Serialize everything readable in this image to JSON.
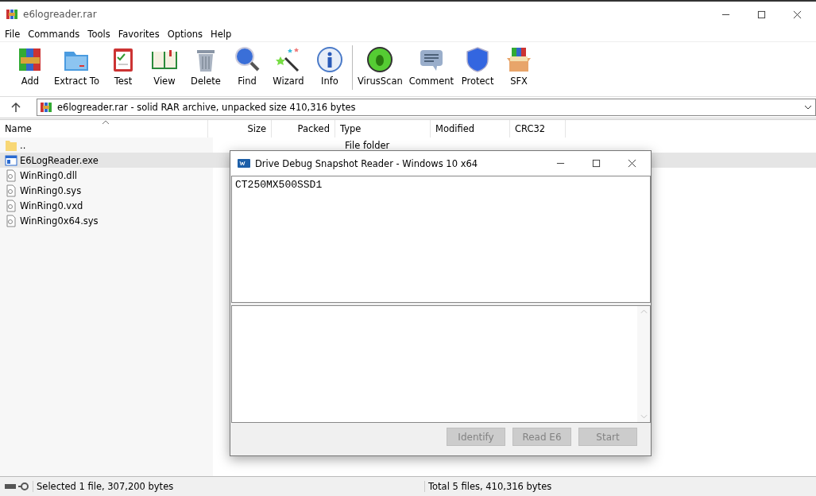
{
  "window": {
    "title": "e6logreader.rar"
  },
  "menu": [
    "File",
    "Commands",
    "Tools",
    "Favorites",
    "Options",
    "Help"
  ],
  "toolbar": [
    "Add",
    "Extract To",
    "Test",
    "View",
    "Delete",
    "Find",
    "Wizard",
    "Info",
    "VirusScan",
    "Comment",
    "Protect",
    "SFX"
  ],
  "address": "e6logreader.rar - solid RAR archive, unpacked size 410,316 bytes",
  "table": {
    "columns": [
      "Name",
      "Size",
      "Packed",
      "Type",
      "Modified",
      "CRC32"
    ],
    "rows": [
      {
        "kind": "folder",
        "name": "..",
        "type": "File folder",
        "selected": false
      },
      {
        "kind": "app",
        "name": "E6LogReader.exe",
        "selected": true
      },
      {
        "kind": "file",
        "name": "WinRing0.dll",
        "selected": false
      },
      {
        "kind": "file",
        "name": "WinRing0.sys",
        "selected": false
      },
      {
        "kind": "file",
        "name": "WinRing0.vxd",
        "selected": false
      },
      {
        "kind": "file",
        "name": "WinRing0x64.sys",
        "selected": false
      }
    ]
  },
  "dialog": {
    "title": "Drive Debug Snapshot Reader - Windows 10 x64",
    "output": "CT250MX500SSD1",
    "buttons": [
      {
        "label": "Identify",
        "disabled": true
      },
      {
        "label": "Read E6",
        "disabled": true
      },
      {
        "label": "Start",
        "disabled": true
      }
    ]
  },
  "status_bar": {
    "left": "Selected 1 file, 307,200 bytes",
    "right": "Total 5 files, 410,316 bytes"
  }
}
